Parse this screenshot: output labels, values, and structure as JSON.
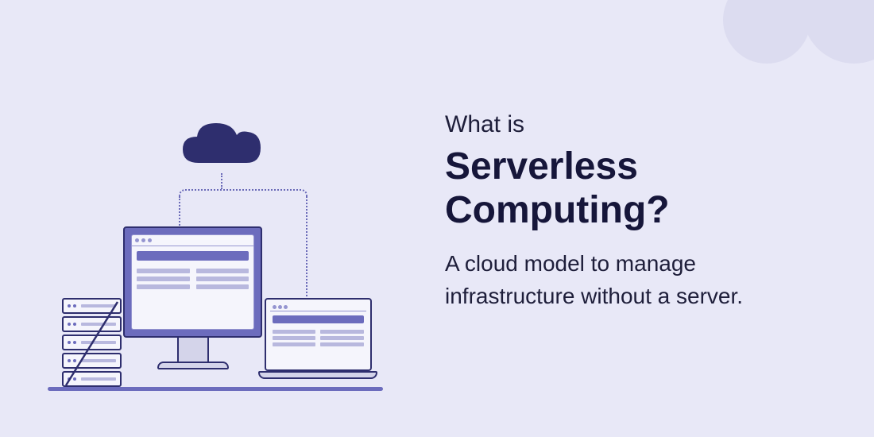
{
  "text": {
    "eyebrow": "What is",
    "title": "Serverless Computing?",
    "subtitle": "A cloud model to manage infrastructure without a server."
  },
  "illustration": {
    "cloud_color": "#2e2e6e",
    "accent_color": "#6c6cbd",
    "line_color": "#2e2e6e",
    "server_units": 5
  },
  "decoration": {
    "circle_color": "#dcdcf0"
  }
}
